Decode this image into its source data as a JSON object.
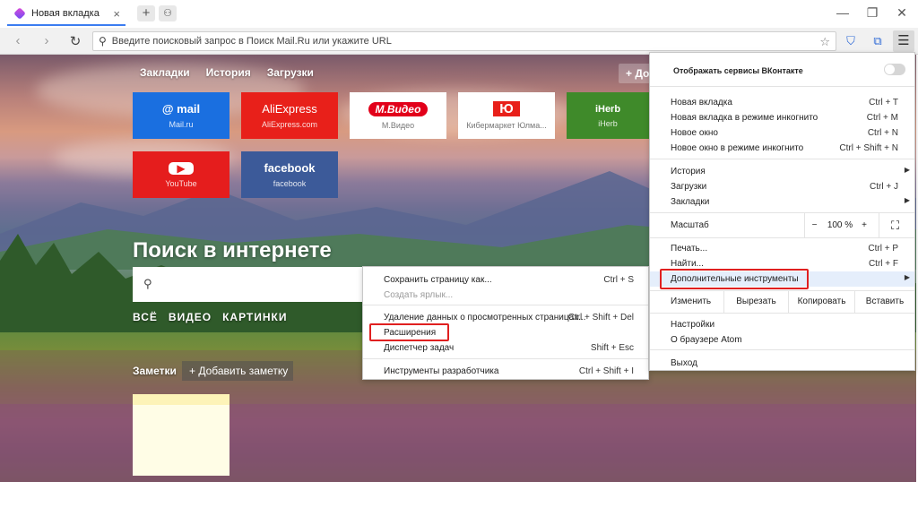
{
  "browser": {
    "tab_title": "Новая вкладка",
    "address_placeholder": "Введите поисковый запрос в Поиск Mail.Ru или укажите URL"
  },
  "icons": {
    "back": "arrow-left-icon",
    "forward": "arrow-right-icon",
    "reload": "reload-icon",
    "search": "search-icon",
    "bookmark": "star-icon",
    "menu": "hamburger-icon"
  },
  "colors": {
    "accent": "#3b7cf0",
    "highlight_box": "#e02020"
  },
  "newtab": {
    "links": [
      "Закладки",
      "История",
      "Загрузки"
    ],
    "add_label": "+ До",
    "tiles": [
      {
        "logo": "@ mail",
        "caption": "Mail.ru",
        "bg": "#1a6fe0"
      },
      {
        "logo": "AliExpress",
        "caption": "AliExpress.com",
        "bg": "#e8201a"
      },
      {
        "logo": "М.Видео",
        "caption": "М.Видео",
        "bg": "#ffffff"
      },
      {
        "logo": "Ю",
        "caption": "Кибермаркет Юлма...",
        "bg": "#ffffff"
      },
      {
        "logo": "iHerb",
        "caption": "iHerb",
        "bg": "#3f8a2a"
      },
      {
        "logo": "▶",
        "caption": "YouTube",
        "bg": "#e51d1d"
      },
      {
        "logo": "facebook",
        "caption": "facebook",
        "bg": "#3c5a99"
      }
    ],
    "search_title": "Поиск в интернете",
    "search_tabs": [
      "ВСЁ",
      "ВИДЕО",
      "КАРТИНКИ"
    ],
    "notes_label": "Заметки",
    "add_note": "+ Добавить заметку"
  },
  "main_menu": {
    "vk_label": "Отображать сервисы ВКонтакте",
    "items1": [
      {
        "label": "Новая вкладка",
        "shortcut": "Ctrl + T"
      },
      {
        "label": "Новая вкладка в режиме инкогнито",
        "shortcut": "Ctrl + M"
      },
      {
        "label": "Новое окно",
        "shortcut": "Ctrl + N"
      },
      {
        "label": "Новое окно в режиме инкогнито",
        "shortcut": "Ctrl + Shift + N"
      }
    ],
    "items2": [
      {
        "label": "История",
        "shortcut": ""
      },
      {
        "label": "Загрузки",
        "shortcut": "Ctrl + J"
      },
      {
        "label": "Закладки",
        "shortcut": ""
      }
    ],
    "zoom_label": "Масштаб",
    "zoom_minus": "−",
    "zoom_value": "100 %",
    "zoom_plus": "+",
    "items3": [
      {
        "label": "Печать...",
        "shortcut": "Ctrl + P"
      },
      {
        "label": "Найти...",
        "shortcut": "Ctrl + F"
      },
      {
        "label": "Дополнительные инструменты",
        "shortcut": ""
      }
    ],
    "edit_label": "Изменить",
    "cut_label": "Вырезать",
    "copy_label": "Копировать",
    "paste_label": "Вставить",
    "settings_label": "Настройки",
    "about_label": "О браузере Atom",
    "exit_label": "Выход"
  },
  "tools_submenu": {
    "items": [
      {
        "label": "Сохранить страницу как...",
        "shortcut": "Ctrl + S"
      },
      {
        "label": "Создать ярлык...",
        "shortcut": ""
      },
      {
        "label": "Удаление данных о просмотренных страницах...",
        "shortcut": "Ctrl + Shift + Del"
      },
      {
        "label": "Расширения",
        "shortcut": ""
      },
      {
        "label": "Диспетчер задач",
        "shortcut": "Shift + Esc"
      },
      {
        "label": "Инструменты разработчика",
        "shortcut": "Ctrl + Shift + I"
      }
    ]
  }
}
